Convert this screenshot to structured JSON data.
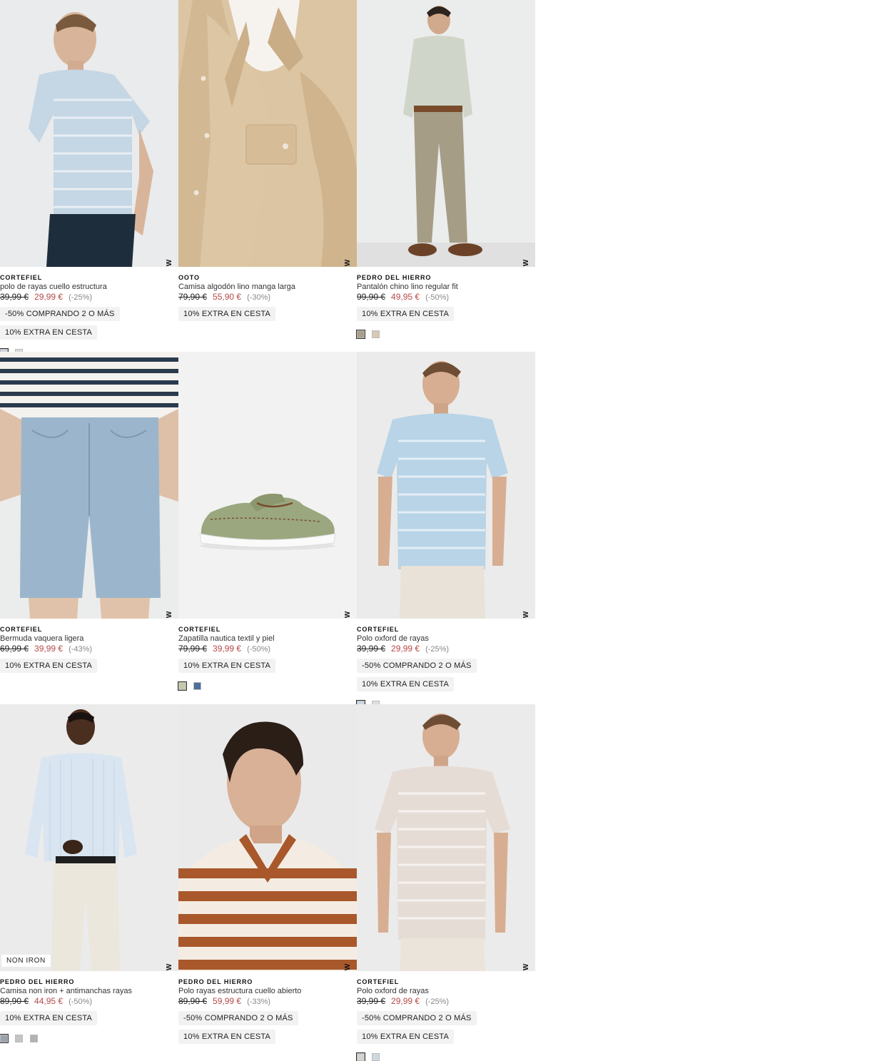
{
  "products": [
    {
      "brand": "CORTEFIEL",
      "name": "polo de rayas cuello estructura",
      "old_price": "39,99 €",
      "new_price": "29,99 €",
      "discount": "(-25%)",
      "badge": "NEW",
      "flag": "",
      "promos": [
        "-50% COMPRANDO 2 O MÁS",
        "10% EXTRA EN CESTA"
      ],
      "swatches": [
        "#cfd6df",
        "#dcdcdc"
      ],
      "image_icon": "man-striped-polo-photo"
    },
    {
      "brand": "OOTO",
      "name": "Camisa algodón lino manga larga",
      "old_price": "79,90 €",
      "new_price": "55,90 €",
      "discount": "(-30%)",
      "badge": "NEW",
      "flag": "",
      "promos": [
        "10% EXTRA EN CESTA"
      ],
      "swatches": [],
      "image_icon": "linen-shirt-closeup-photo"
    },
    {
      "brand": "PEDRO DEL HIERRO",
      "name": "Pantalón chino lino regular fit",
      "old_price": "99,90 €",
      "new_price": "49,95 €",
      "discount": "(-50%)",
      "badge": "NEW",
      "flag": "",
      "promos": [
        "10% EXTRA EN CESTA"
      ],
      "swatches": [
        "#a9a08a",
        "#d8c8b4"
      ],
      "image_icon": "man-chino-pants-photo"
    },
    {
      "brand": "CORTEFIEL",
      "name": "Bermuda vaquera ligera",
      "old_price": "69,99 €",
      "new_price": "39,99 €",
      "discount": "(-43%)",
      "badge": "NEW",
      "flag": "",
      "promos": [
        "10% EXTRA EN CESTA"
      ],
      "swatches": [],
      "image_icon": "denim-shorts-photo"
    },
    {
      "brand": "CORTEFIEL",
      "name": "Zapatilla nautica textil y piel",
      "old_price": "79,99 €",
      "new_price": "39,99 €",
      "discount": "(-50%)",
      "badge": "NEW",
      "flag": "",
      "promos": [
        "10% EXTRA EN CESTA"
      ],
      "swatches": [
        "#c6c9a8",
        "#4e6e9c"
      ],
      "image_icon": "boat-shoe-photo"
    },
    {
      "brand": "CORTEFIEL",
      "name": "Polo oxford de rayas",
      "old_price": "39,99 €",
      "new_price": "29,99 €",
      "discount": "(-25%)",
      "badge": "NEW",
      "flag": "",
      "promos": [
        "-50% COMPRANDO 2 O MÁS",
        "10% EXTRA EN CESTA"
      ],
      "swatches": [
        "#c9d8e6",
        "#dedede"
      ],
      "image_icon": "man-blue-polo-photo"
    },
    {
      "brand": "PEDRO DEL HIERRO",
      "name": "Camisa non iron + antimanchas rayas",
      "old_price": "89,90 €",
      "new_price": "44,95 €",
      "discount": "(-50%)",
      "badge": "NEW",
      "flag": "NON IRON",
      "promos": [
        "10% EXTRA EN CESTA"
      ],
      "swatches": [
        "#9aa3ad",
        "#c4c4c4",
        "#b2b2b2"
      ],
      "image_icon": "man-striped-shirt-photo"
    },
    {
      "brand": "PEDRO DEL HIERRO",
      "name": "Polo rayas estructura cuello abierto",
      "old_price": "89,90 €",
      "new_price": "59,99 €",
      "discount": "(-33%)",
      "badge": "NEW",
      "flag": "",
      "promos": [
        "-50% COMPRANDO 2 O MÁS",
        "10% EXTRA EN CESTA"
      ],
      "swatches": [],
      "image_icon": "man-brown-stripe-polo-photo"
    },
    {
      "brand": "CORTEFIEL",
      "name": "Polo oxford de rayas",
      "old_price": "39,99 €",
      "new_price": "29,99 €",
      "discount": "(-25%)",
      "badge": "NEW",
      "flag": "",
      "promos": [
        "-50% COMPRANDO 2 O MÁS",
        "10% EXTRA EN CESTA"
      ],
      "swatches": [
        "#d7d3cf",
        "#cfd8dc"
      ],
      "image_icon": "man-pink-polo-photo"
    }
  ]
}
